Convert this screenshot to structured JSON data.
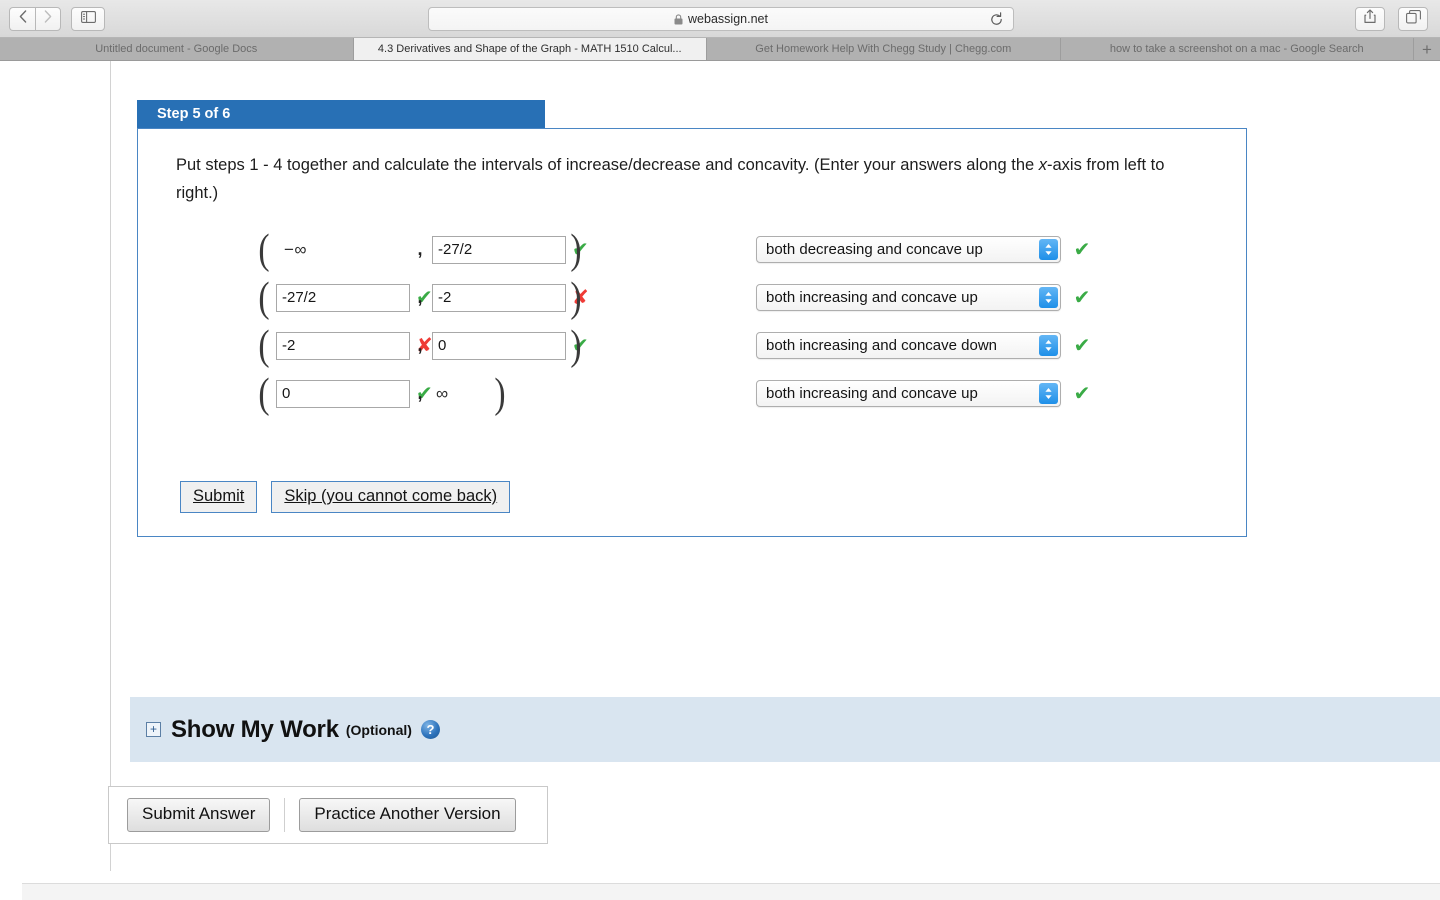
{
  "browser": {
    "url": "webassign.net",
    "lock_icon": "lock-icon",
    "reload_icon": "reload-icon",
    "back_icon": "chevron-left-icon",
    "forward_icon": "chevron-right-icon",
    "sidebar_icon": "sidebar-toggle-icon",
    "share_icon": "share-icon",
    "tabs_icon": "show-all-tabs-icon",
    "new_tab_label": "+",
    "tabs": [
      {
        "title": "Untitled document - Google Docs",
        "active": false
      },
      {
        "title": "4.3 Derivatives and Shape of the Graph - MATH 1510 Calcul...",
        "active": true
      },
      {
        "title": "Get Homework Help With Chegg Study | Chegg.com",
        "active": false
      },
      {
        "title": "how to take a screenshot on a mac - Google Search",
        "active": false
      }
    ]
  },
  "step": {
    "header": "Step 5 of 6",
    "question_part1": "Put steps 1 - 4 together and calculate the intervals of increase/decrease and concavity. (Enter your answers along the ",
    "question_italic": "x",
    "question_part2": "-axis from left to right.)",
    "paren_open": "(",
    "paren_close": ")",
    "comma": ",",
    "check_glyph": "✔",
    "cross_glyph": "✘",
    "select_arrows": "⌃⌄"
  },
  "intervals": [
    {
      "left": {
        "kind": "static",
        "value": "−∞",
        "mark": "none"
      },
      "right": {
        "kind": "input",
        "value": "-27/2",
        "mark": "correct"
      },
      "select": {
        "value": "both decreasing and concave up",
        "mark": "correct"
      }
    },
    {
      "left": {
        "kind": "input",
        "value": "-27/2",
        "mark": "correct"
      },
      "right": {
        "kind": "input",
        "value": "-2",
        "mark": "incorrect"
      },
      "select": {
        "value": "both increasing and concave up",
        "mark": "correct"
      }
    },
    {
      "left": {
        "kind": "input",
        "value": "-2",
        "mark": "incorrect"
      },
      "right": {
        "kind": "input",
        "value": "0",
        "mark": "correct"
      },
      "select": {
        "value": "both increasing and concave down",
        "mark": "correct"
      }
    },
    {
      "left": {
        "kind": "input",
        "value": "0",
        "mark": "correct"
      },
      "right": {
        "kind": "static-short",
        "value": "∞",
        "mark": "none"
      },
      "select": {
        "value": "both increasing and concave up",
        "mark": "correct"
      }
    }
  ],
  "actions": {
    "submit_label": "Submit",
    "skip_label": "Skip (you cannot come back)"
  },
  "show_my_work": {
    "expand_glyph": "+",
    "title": "Show My Work",
    "optional": "(Optional)",
    "help_glyph": "?"
  },
  "bottom": {
    "submit_answer_label": "Submit Answer",
    "practice_label": "Practice Another Version"
  },
  "colors": {
    "step_header_blue": "#2870b5",
    "card_border_blue": "#4a86c4",
    "correct_green": "#3aab46",
    "incorrect_red": "#ef3b36",
    "show_my_work_bg": "#d9e5f0",
    "select_arrow_blue": "#1e8fe8"
  }
}
